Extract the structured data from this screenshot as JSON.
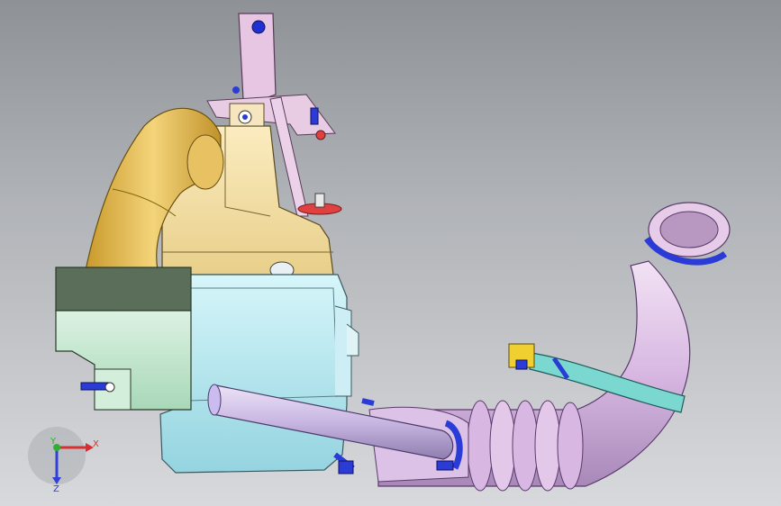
{
  "viewport": {
    "background_top": "#8e9296",
    "background_bottom": "#d8d9dc"
  },
  "model": {
    "parts": [
      {
        "name": "intake-bracket",
        "color": "#e8c8e0"
      },
      {
        "name": "upper-housing",
        "color": "#f2dfa6"
      },
      {
        "name": "elbow-duct",
        "color": "#e8c25c"
      },
      {
        "name": "filter-box-lower",
        "color": "#b8eaf0"
      },
      {
        "name": "resonator-box",
        "color": "#c8ead0"
      },
      {
        "name": "straight-pipe",
        "color": "#d6c8ec"
      },
      {
        "name": "corrugated-hose",
        "color": "#e6c8ec"
      },
      {
        "name": "breather-hose",
        "color": "#7ad8d0"
      },
      {
        "name": "hose-clamps",
        "color": "#2a3bd6"
      },
      {
        "name": "breather-connector",
        "color": "#f0d030"
      },
      {
        "name": "mount-grommet",
        "color": "#e04040"
      }
    ]
  },
  "triad": {
    "x_label": "X",
    "y_label": "Y",
    "z_label": "Z",
    "x_color": "#d83030",
    "y_color": "#30b030",
    "z_color": "#3040d8"
  }
}
